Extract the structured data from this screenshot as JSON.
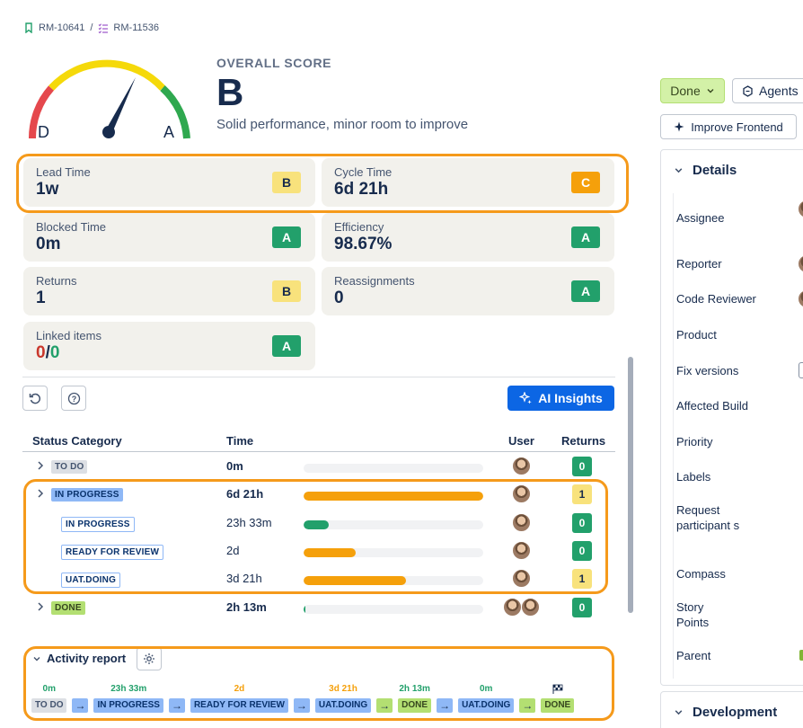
{
  "breadcrumb": [
    {
      "key": "RM-10641",
      "icon": "bookmark-icon"
    },
    {
      "key": "RM-11536",
      "icon": "subtask-list-icon"
    }
  ],
  "breadcrumb_sep": "/",
  "gauge": {
    "low_label": "D",
    "high_label": "A",
    "colors": [
      "#e5484d",
      "#f5d90a",
      "#2fa84f"
    ]
  },
  "score": {
    "label": "OVERALL SCORE",
    "grade": "B",
    "description": "Solid performance, minor room to improve"
  },
  "metrics": {
    "lead_time": {
      "title": "Lead Time",
      "value": "1w",
      "grade": "B"
    },
    "cycle_time": {
      "title": "Cycle Time",
      "value": "6d 21h",
      "grade": "C"
    },
    "blocked_time": {
      "title": "Blocked Time",
      "value": "0m",
      "grade": "A"
    },
    "efficiency": {
      "title": "Efficiency",
      "value": "98.67%",
      "grade": "A"
    },
    "returns": {
      "title": "Returns",
      "value": "1",
      "grade": "B"
    },
    "reassignments": {
      "title": "Reassignments",
      "value": "0",
      "grade": "A"
    },
    "linked": {
      "title": "Linked items",
      "value_red": "0",
      "sep": "/",
      "value_green": "0",
      "grade": "A"
    }
  },
  "toolbar": {
    "ai_insights": "AI Insights",
    "reset_icon": "reset-icon",
    "help_icon": "help-icon"
  },
  "table": {
    "headers": {
      "status": "Status Category",
      "time": "Time",
      "user": "User",
      "returns": "Returns"
    },
    "rows": [
      {
        "status": "TO DO",
        "time": "0m",
        "progress": 0.0,
        "returns": "0"
      },
      {
        "status": "IN PROGRESS",
        "time": "6d 21h",
        "progress": 1.0,
        "returns": "1"
      },
      {
        "status": "IN PROGRESS",
        "time": "23h 33m",
        "progress": 0.14,
        "returns": "0"
      },
      {
        "status": "READY FOR REVIEW",
        "time": "2d",
        "progress": 0.29,
        "returns": "0"
      },
      {
        "status": "UAT.DOING",
        "time": "3d 21h",
        "progress": 0.57,
        "returns": "1"
      },
      {
        "status": "DONE",
        "time": "2h 13m",
        "progress": 0.01,
        "returns": "0"
      }
    ]
  },
  "activity": {
    "title": "Activity report",
    "steps": [
      {
        "duration": "0m",
        "status": "TO DO"
      },
      {
        "duration": "23h 33m",
        "status": "IN PROGRESS"
      },
      {
        "duration": "2d",
        "status": "READY FOR REVIEW"
      },
      {
        "duration": "3d 21h",
        "status": "UAT.DOING"
      },
      {
        "duration": "2h 13m",
        "status": "DONE"
      },
      {
        "duration": "0m",
        "status": "UAT.DOING"
      },
      {
        "duration": "",
        "status": "DONE"
      }
    ]
  },
  "right_panel": {
    "status": "Done",
    "agents": "Agents",
    "improve": "Improve Frontend",
    "details_title": "Details",
    "fields": [
      "Assignee",
      "Reporter",
      "Code Reviewer",
      "Product",
      "Fix versions",
      "Affected Build",
      "Priority",
      "Labels",
      "Request participant s",
      "Compass",
      "Story Points",
      "Parent"
    ],
    "development_title": "Development"
  }
}
